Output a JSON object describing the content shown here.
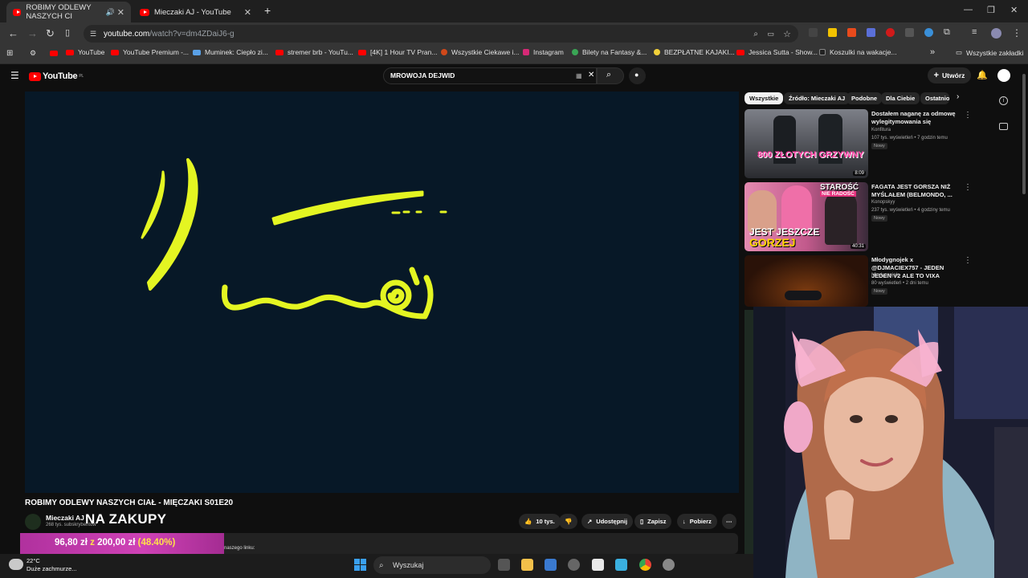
{
  "browser": {
    "tabs": [
      {
        "title": "ROBIMY ODLEWY NASZYCH CI",
        "active": true
      },
      {
        "title": "Mieczaki AJ - YouTube",
        "active": false
      }
    ],
    "address": {
      "host": "youtube.com",
      "path": "/watch?v=dm4ZDaiJ6-g"
    },
    "bookmarks": [
      "YouTube",
      "YouTube Premium -...",
      "Muminek: Ciepło zi...",
      "stremer brb - YouTu...",
      "[4K] 1 Hour TV Pran...",
      "Wszystkie Ciekawe i...",
      "Instagram",
      "Bilety na Fantasy &...",
      "BEZPŁATNE KAJAKI...",
      "Jessica Sutta - Show...",
      "Koszulki na wakacje...",
      "Wszystkie zakładki"
    ]
  },
  "youtube": {
    "logo": "YouTube",
    "logo_region": "PL",
    "search_value": "MROWOJA DEJWID",
    "create_label": "Utwórz"
  },
  "video": {
    "title": "ROBIMY ODLEWY NASZYCH CIAŁ - MIĘCZAKI S01E20",
    "channel": "Mieczaki AJ",
    "subscribers": "268 tys. subskrybentów",
    "overlay_text": "NA ZAKUPY",
    "actions": {
      "likes": "10 tys.",
      "share": "Udostępnij",
      "save": "Zapisz",
      "download": "Pobierz"
    },
    "description_fragment": "naszego linku:"
  },
  "donation": {
    "current": "96,80 zł",
    "sep": "z",
    "goal": "200,00 zł",
    "percent": "(48.40%)",
    "progress": 0.484
  },
  "filters": [
    "Wszystkie",
    "Źródło: Mieczaki AJ",
    "Podobne",
    "Dla Ciebie",
    "Ostatnio"
  ],
  "recommendations": [
    {
      "title": "Dostałem naganę za odmowę wylegitymowania się",
      "channel": "Konfitura",
      "meta": "107 tys. wyświetleń • 7 godzin temu",
      "badge": "Nowy",
      "duration": "8:09",
      "thumb_text": "800 ZŁOTYCH GRZYWNY"
    },
    {
      "title": "FAGATA JEST GORSZA NIŻ MYŚLAŁEM (BELMONDO, ...",
      "channel": "Konopskyy",
      "meta": "237 tys. wyświetleń • 4 godziny temu",
      "badge": "Nowy",
      "duration": "40:31",
      "thumb_text_top": "STAROŚĆ",
      "thumb_text_top2": "NIE RADOŚĆ",
      "thumb_text_bottom1": "JEST JESZCZE",
      "thumb_text_bottom2": "GORZEJ"
    },
    {
      "title": "Młodygnojek x @DJMACIEX757 - JEDEN JEDEN V2 ALE TO VIXA",
      "channel": "Młodygnojek",
      "meta": "80 wyświetleń • 2 dni temu",
      "badge": "Nowy"
    }
  ],
  "taskbar": {
    "temp": "22°C",
    "weather": "Duże zachmurze...",
    "search": "Wyszukaj"
  },
  "colors": {
    "accent_red": "#ff0000",
    "player_bg": "#071827",
    "drawing": "#e4f522",
    "donate_pink": "#c23aa8"
  }
}
